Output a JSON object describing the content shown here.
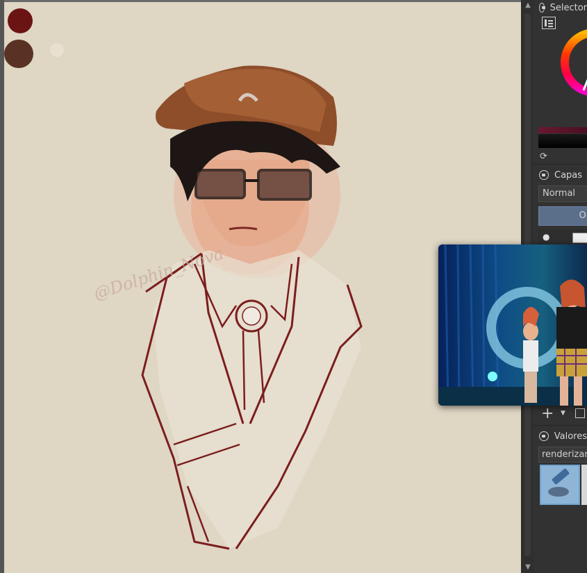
{
  "canvas": {
    "background": "#dfd6c4",
    "watermark": "@Dolphin_Nova",
    "swatches": [
      "#6b1414",
      "#5a3224",
      "#e8e1cf"
    ]
  },
  "panel": {
    "selector_title": "Selector",
    "layers_title": "Capas",
    "blend_mode": "Normal",
    "layer_button": "Op",
    "brush_title": "Valores",
    "brush_field": "renderizar"
  },
  "icons": [
    "scroll-up-icon",
    "scroll-down-icon",
    "lock-icon",
    "list-view-icon",
    "refresh-icon",
    "eye-icon",
    "add-layer-icon",
    "dropdown-icon",
    "duplicate-layer-icon"
  ],
  "colors": {
    "panel_bg": "#323232",
    "accent": "#5b6f8a"
  }
}
